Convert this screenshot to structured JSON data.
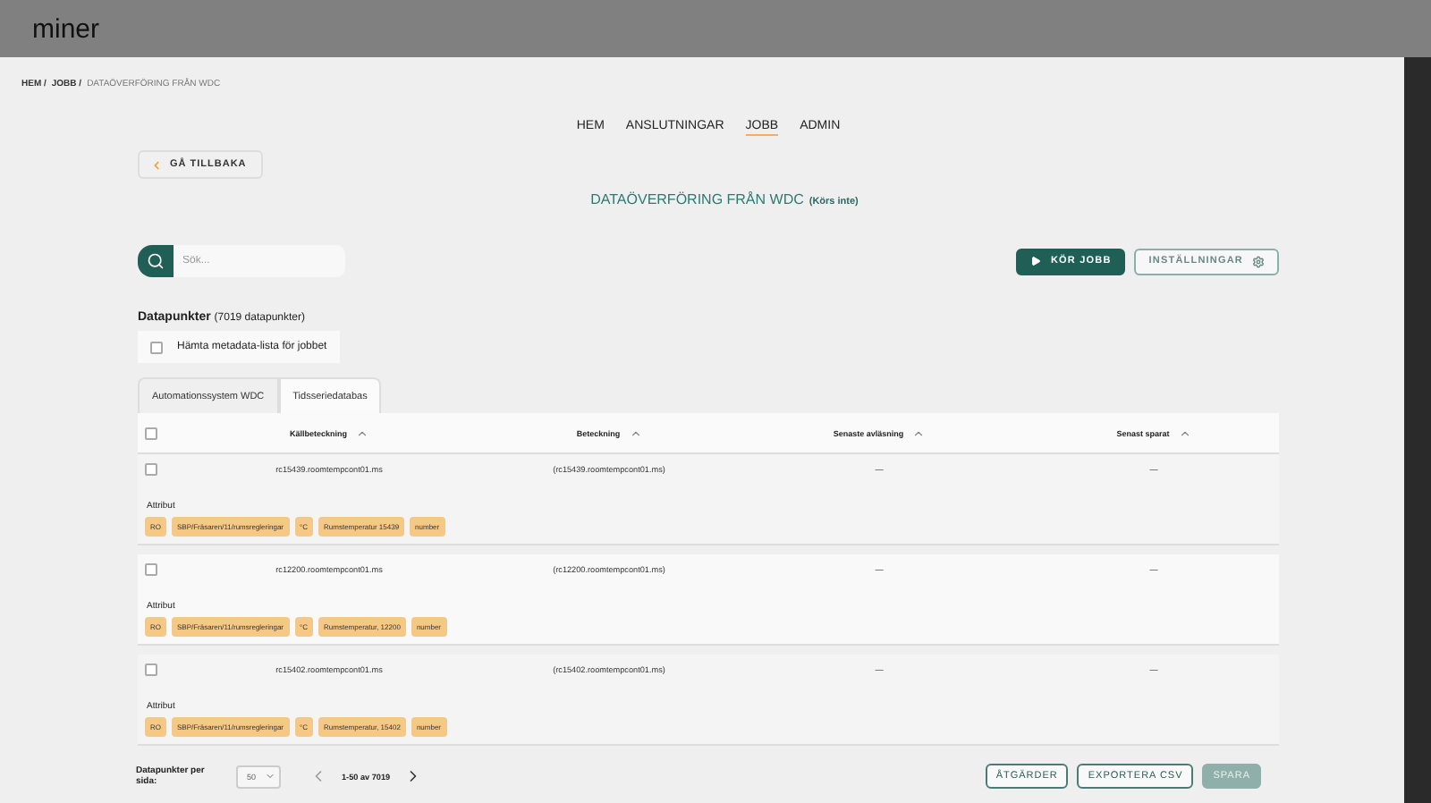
{
  "header": {
    "logo": "miner"
  },
  "breadcrumb": [
    "HEM /",
    "JOBB /",
    "DATAÖVERFÖRING FRÅN WDC"
  ],
  "nav": [
    {
      "label": "HEM",
      "selected": false
    },
    {
      "label": "ANSLUTNINGAR",
      "selected": false
    },
    {
      "label": "JOBB",
      "selected": true
    },
    {
      "label": "ADMIN",
      "selected": false
    }
  ],
  "back_button": "GÅ TILLBAKA",
  "title": {
    "text": "DATAÖVERFÖRING FRÅN WDC",
    "status": "(Körs inte)"
  },
  "search": {
    "placeholder": "Sök..."
  },
  "actions": [
    "KÖR JOBB",
    "INSTÄLLNINGAR"
  ],
  "datapoints": {
    "heading": "Datapunkter",
    "count": "(7019 datapunkter)"
  },
  "metadata_checkbox": {
    "label": "Hämta metadata-lista för jobbet",
    "checked": false
  },
  "tabs": [
    {
      "label": "Automationssystem WDC",
      "selected": false
    },
    {
      "label": "Tidsseriedatabas",
      "selected": true
    }
  ],
  "table": {
    "columns": [
      "Källbeteckning",
      "Beteckning",
      "Senaste avläsning",
      "Senast sparat"
    ],
    "select_all_checked": false,
    "rows": [
      {
        "checked": false,
        "cells": [
          "rc15439.roomtempcont01.ms",
          "(rc15439.roomtempcont01.ms)",
          "—",
          "—"
        ],
        "attr_label": "Attribut",
        "tags": [
          "RO",
          "SBP/Fräsaren/11/rumsregleringar",
          "°C",
          "Rumstemperatur 15439",
          "number"
        ]
      },
      {
        "checked": false,
        "cells": [
          "rc12200.roomtempcont01.ms",
          "(rc12200.roomtempcont01.ms)",
          "—",
          "—"
        ],
        "attr_label": "Attribut",
        "tags": [
          "RO",
          "SBP/Fräsaren/11/rumsregleringar",
          "°C",
          "Rumstemperatur, 12200",
          "number"
        ]
      },
      {
        "checked": false,
        "cells": [
          "rc15402.roomtempcont01.ms",
          "(rc15402.roomtempcont01.ms)",
          "—",
          "—"
        ],
        "attr_label": "Attribut",
        "tags": [
          "RO",
          "SBP/Fräsaren/11/rumsregleringar",
          "°C",
          "Rumstemperatur, 15402",
          "number"
        ]
      }
    ]
  },
  "footer": {
    "per_page_label": "Datapunkter per sida:",
    "per_page": "50",
    "range": "1-50 av 7019",
    "buttons": [
      {
        "label": "ÅTGÄRDER",
        "disabled": false
      },
      {
        "label": "EXPORTERA CSV",
        "disabled": false
      },
      {
        "label": "SPARA",
        "disabled": true
      }
    ]
  }
}
